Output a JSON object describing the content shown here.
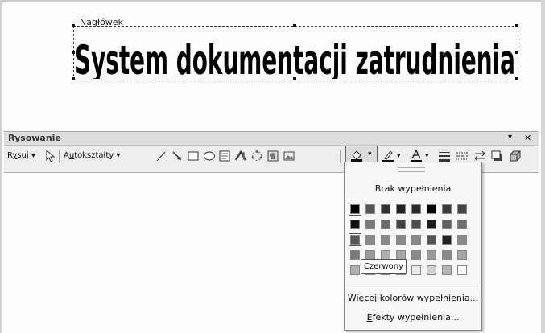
{
  "document": {
    "header_label": "Nagłówek",
    "wordart_text": "System dokumentacji zatrudnienia"
  },
  "toolbar": {
    "title": "Rysowanie",
    "draw_menu": {
      "pre": "R",
      "accel": "y",
      "post": "suj ▾"
    },
    "autoshapes_menu": {
      "pre": "A",
      "accel": "u",
      "post": "tokształty ▾"
    },
    "close_glyph": "✕",
    "options_glyph": "▾"
  },
  "fill_dropdown": {
    "no_fill_label": "Brak wypełnienia",
    "more_colors": {
      "pre": "",
      "accel": "W",
      "post": "ięcej kolorów wypełnienia..."
    },
    "fill_effects": {
      "pre": "",
      "accel": "E",
      "post": "fekty wypełnienia..."
    },
    "colors": [
      [
        "#000000",
        "#555555",
        "#333333",
        "#222222",
        "#2a2a2a",
        "#000000",
        "#3a3a3a",
        "#444444"
      ],
      [
        "#111111",
        "#7a7a7a",
        "#6a6a6a",
        "#444444",
        "#4e4e4e",
        "#1a1a1a",
        "#606060",
        "#707070"
      ],
      [
        "#555555",
        "#8a8a8a",
        "#8a8a8a",
        "#8a8a8a",
        "#8a8a8a",
        "#555555",
        "#222222",
        "#8a8a8a"
      ],
      [
        "#7a7a7a",
        "#9a9a9a",
        "#b0b0b0",
        "#a5a5a5",
        "#8a8a8a",
        "#9a9a9a",
        "#8a8a8a",
        "#a5a5a5"
      ],
      [
        "#b0b0b0",
        "#c5c5c5",
        "#d8d8d8",
        "#e4e4e4",
        "#e8e8e8",
        "#d0d0d0",
        "#b5b5b5",
        "#ffffff"
      ]
    ],
    "selected_swatches": [
      [
        0,
        0
      ],
      [
        2,
        0
      ]
    ]
  },
  "tooltip": {
    "text": "Czerwony"
  },
  "colors": {
    "toolbar_bg": "#eeeeee",
    "dropdown_bg": "#f7f7f7",
    "wordart_fill": "#000000"
  },
  "icons": {
    "select": "cursor-arrow-icon",
    "line": "line-icon",
    "arrow": "arrow-icon",
    "rectangle": "rectangle-icon",
    "oval": "oval-icon",
    "textbox": "textbox-icon",
    "wordart": "wordart-icon",
    "diagram": "diagram-icon",
    "clipart": "clipart-icon",
    "picture": "picture-icon",
    "fill": "fill-color-icon",
    "line_color": "line-color-icon",
    "font_color": "font-color-icon",
    "line_style": "line-style-icon",
    "dash_style": "dash-style-icon",
    "arrow_style": "arrow-style-icon",
    "shadow": "shadow-icon",
    "threed": "3d-icon"
  }
}
